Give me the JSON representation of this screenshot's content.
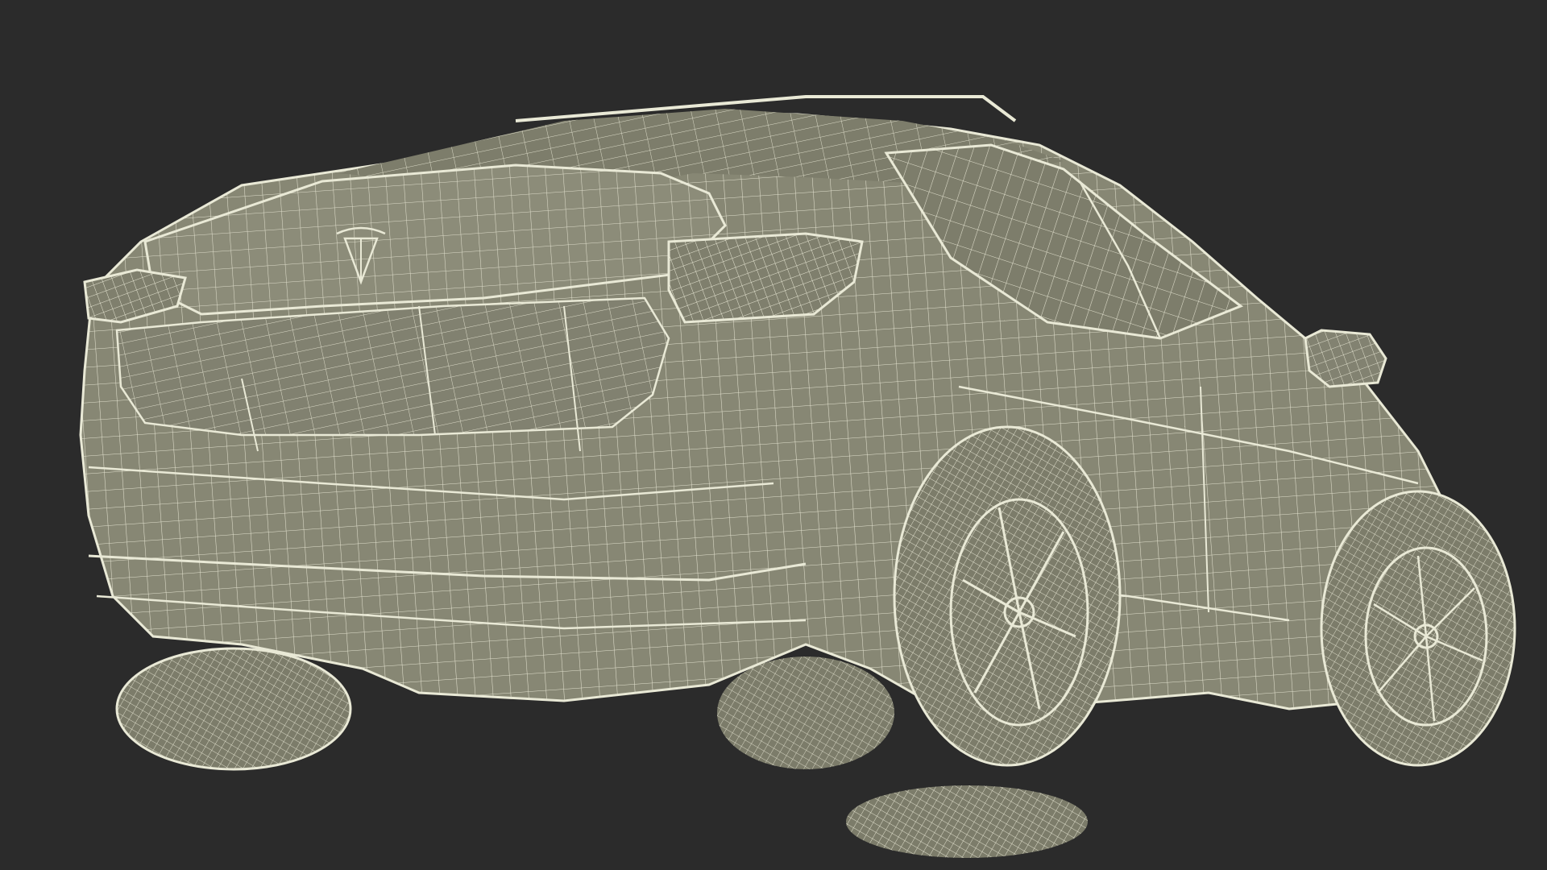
{
  "scene": {
    "subject": "wireframe-car-rear-three-quarter",
    "colors": {
      "background": "#2b2b2b",
      "body_fill": "#878774",
      "body_shadow": "#6f6f5f",
      "glass_fill": "#7d7d6b",
      "tire_fill": "#7c7c6a",
      "wire": "#e9e9d6"
    },
    "icons": [
      "tesla-logo-icon",
      "side-mirror",
      "rear-left-wheel",
      "front-left-wheel",
      "rear-right-wheel"
    ]
  }
}
